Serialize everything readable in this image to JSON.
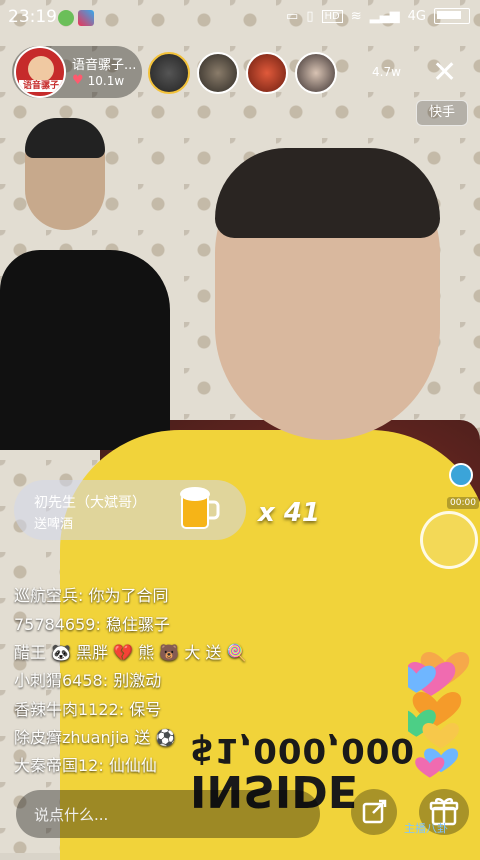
{
  "status_bar": {
    "time": "23:19",
    "network": "4G",
    "hd_label": "HD"
  },
  "host": {
    "avatar_text": "语音骡子",
    "name": "语音骡子...",
    "likes": "10.1w"
  },
  "viewer_count": "4.7w",
  "platform_label": "快手",
  "gift_banner": {
    "sender": "初先生（大斌哥）",
    "action": "送啤酒",
    "count": "x 41"
  },
  "record_time": "00:00",
  "comments": [
    {
      "user": "巡航空兵:",
      "message": " 你为了合同"
    },
    {
      "user": "75784659:",
      "message": " 稳住骡子"
    },
    {
      "user": "醋王",
      "message": "黑胖",
      "tail": "熊",
      "extra": "大 送"
    },
    {
      "user": "小刺猬6458:",
      "message": " 别激动"
    },
    {
      "user": "香辣牛肉1122:",
      "message": " 保号"
    },
    {
      "user": "除皮癣zhuanjia",
      "message": " 送"
    },
    {
      "user": "大秦帝国12:",
      "message": " 仙仙仙"
    }
  ],
  "shirt_text": {
    "line1": "$1,000,000",
    "line2": "INSIDE"
  },
  "input_placeholder": "说点什么...",
  "watermark": "主播八卦",
  "colors": {
    "accent_heart": "#ff5a6e",
    "shirt": "#f1d33a",
    "host_badge": "#c62b2b"
  }
}
